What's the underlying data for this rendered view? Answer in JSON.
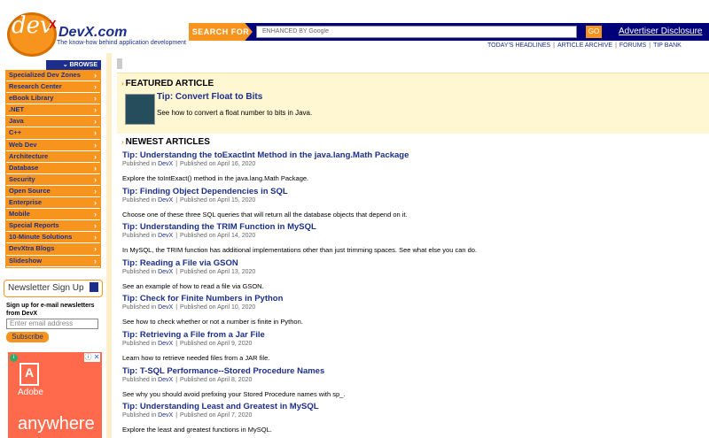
{
  "header": {
    "logo_text": "dev",
    "logo_superscript": "X",
    "brand": "DevX.com",
    "tagline": "The know-how behind application development",
    "search_label": "SEARCH FOR",
    "search_placeholder": "ENHANCED BY Google",
    "go_label": "GO",
    "advertiser_link": "Advertiser Disclosure",
    "top_links": [
      "TODAY'S HEADLINES",
      "ARTICLE ARCHIVE",
      "FORUMS",
      "TIP BANK"
    ]
  },
  "sidebar": {
    "browse_label": "BROWSE DEVX",
    "items": [
      "Specialized Dev Zones",
      "Research Center",
      "eBook Library",
      ".NET",
      "Java",
      "C++",
      "Web Dev",
      "Architecture",
      "Database",
      "Security",
      "Open Source",
      "Enterprise",
      "Mobile",
      "Special Reports",
      "10-Minute Solutions",
      "DevXtra Blogs",
      "Slideshow"
    ]
  },
  "newsletter": {
    "title": "Newsletter Sign Up",
    "description": "Sign up for e-mail newsletters from DevX",
    "email_placeholder": "Enter email address",
    "subscribe_label": "Subscribe"
  },
  "ad": {
    "brand": "Adobe",
    "tagline": "anywhere",
    "close_label": "ⓘ ✕"
  },
  "featured": {
    "heading": "FEATURED ARTICLE",
    "title": "Tip: Convert Float to Bits",
    "description": "See how to convert a float number to bits in Java."
  },
  "newest": {
    "heading": "NEWEST ARTICLES",
    "articles": [
      {
        "title": "Tip: Understandng the toExactInt Method in the java.lang.Math Package",
        "source": "DevX",
        "date": "Published on April 16, 2020",
        "description": "Explore the toIntExact() method in the java.lang.Math Package."
      },
      {
        "title": "Tip: Finding Object Dependencies in SQL",
        "source": "DevX",
        "date": "Published on April 15, 2020",
        "description": "Choose one of these three SQL queries that will return all the database objects that depend on it."
      },
      {
        "title": "Tip: Understanding the TRIM Function in MySQL",
        "source": "DevX",
        "date": "Published on April 14, 2020",
        "description": "In MySQL, the TRIM function has additional implementations other than just trimming spaces. See what else you can do."
      },
      {
        "title": "Tip: Reading a File via GSON",
        "source": "DevX",
        "date": "Published on April 13, 2020",
        "description": "See an example of how to read a file via GSON."
      },
      {
        "title": "Tip: Check for Finite Numbers in Python",
        "source": "DevX",
        "date": "Published on April 10, 2020",
        "description": "See how to check whether or not a number is finite in Python."
      },
      {
        "title": "Tip: Retrieving a File from a Jar File",
        "source": "DevX",
        "date": "Published on April 9, 2020",
        "description": "Learn how to retrieve needed files from a JAR file."
      },
      {
        "title": "Tip: T-SQL Performance--Stored Procedure Names",
        "source": "DevX",
        "date": "Published on April 8, 2020",
        "description": "See why you should avoid prefixing your Stored Procedure names with sp_."
      },
      {
        "title": "Tip: Understanding Least and Greatest in MySQL",
        "source": "DevX",
        "date": "Published on April 7, 2020",
        "description": "Explore the least and greatest functions in MySQL."
      }
    ],
    "published_in_label": "Published in",
    "separator": "|"
  },
  "colors": {
    "brand_blue": "#1c2f8c",
    "brand_orange": "#f7941d",
    "featured_bg": "#fff6d2"
  }
}
